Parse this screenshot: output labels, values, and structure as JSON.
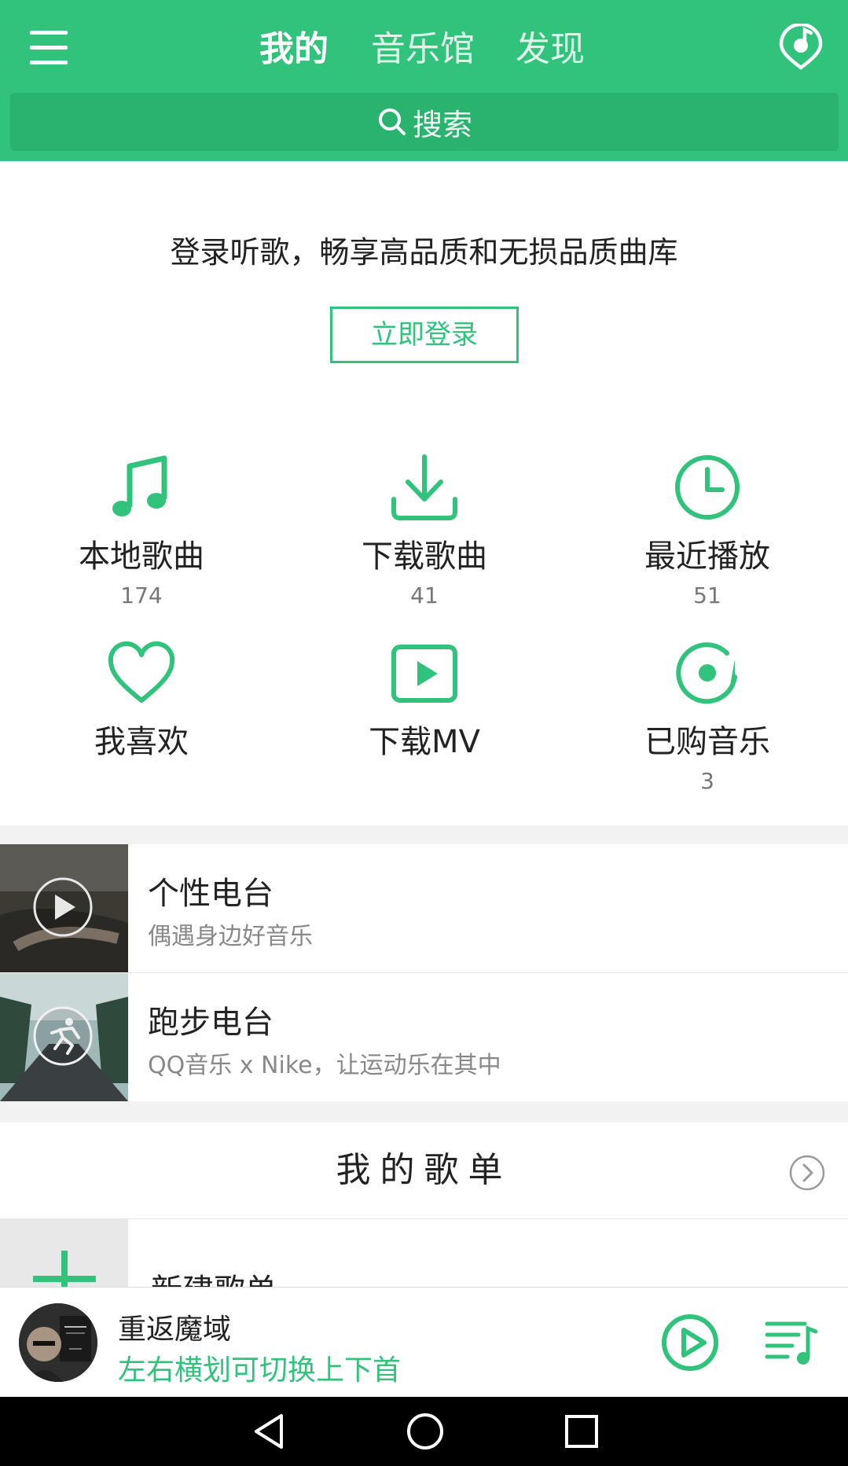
{
  "header": {
    "tabs": [
      {
        "label": "我的",
        "active": true
      },
      {
        "label": "音乐馆",
        "active": false
      },
      {
        "label": "发现",
        "active": false
      }
    ],
    "search_label": "搜索"
  },
  "login": {
    "prompt": "登录听歌，畅享高品质和无损品质曲库",
    "button_label": "立即登录"
  },
  "grid": [
    {
      "icon": "music-note-icon",
      "label": "本地歌曲",
      "count": "174"
    },
    {
      "icon": "download-icon",
      "label": "下载歌曲",
      "count": "41"
    },
    {
      "icon": "clock-icon",
      "label": "最近播放",
      "count": "51"
    },
    {
      "icon": "heart-icon",
      "label": "我喜欢",
      "count": ""
    },
    {
      "icon": "video-play-icon",
      "label": "下载MV",
      "count": ""
    },
    {
      "icon": "purchased-disc-icon",
      "label": "已购音乐",
      "count": "3"
    }
  ],
  "radios": [
    {
      "title": "个性电台",
      "subtitle": "偶遇身边好音乐",
      "icon": "play-icon"
    },
    {
      "title": "跑步电台",
      "subtitle": "QQ音乐 x Nike，让运动乐在其中",
      "icon": "runner-icon"
    }
  ],
  "playlists": {
    "title": "我的歌单",
    "new_label": "新建歌单"
  },
  "player": {
    "song_title": "重返魔域",
    "hint": "左右横划可切换上下首"
  },
  "colors": {
    "brand_green": "#31c27c",
    "search_bg": "#2ab26f",
    "band_gray": "#f2f2f2"
  }
}
